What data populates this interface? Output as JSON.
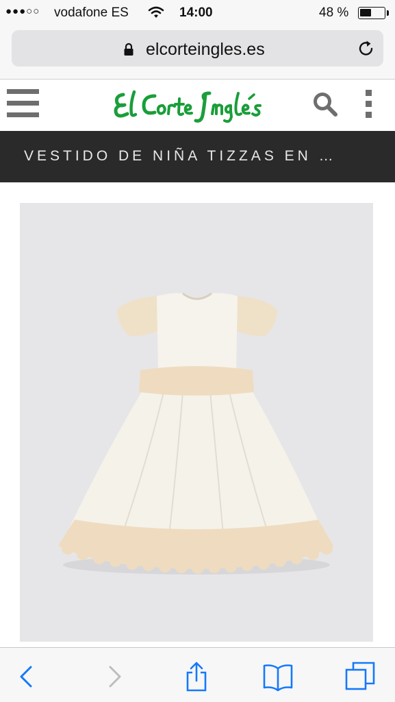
{
  "status_bar": {
    "signal": "●●●○○",
    "carrier": "vodafone ES",
    "time": "14:00",
    "battery_percent": "48 %",
    "battery_level": 0.48
  },
  "browser": {
    "url": "elcorteingles.es",
    "lock_icon": "lock-icon",
    "reload_icon": "reload-icon"
  },
  "site_header": {
    "brand": "El Corte Inglés",
    "brand_color": "#1a9e3a",
    "menu_icon": "hamburger-menu-icon",
    "search_icon": "search-icon",
    "more_icon": "more-vertical-icon"
  },
  "product": {
    "title": "VESTIDO DE NIÑA TIZZAS EN …",
    "image_alt": "white girl's dress with beige lace"
  },
  "toolbar": {
    "items": [
      "back-icon",
      "forward-icon",
      "share-icon",
      "bookmarks-icon",
      "tabs-icon"
    ],
    "accent": "#1479fb",
    "disabled": "#bdbdbd"
  }
}
